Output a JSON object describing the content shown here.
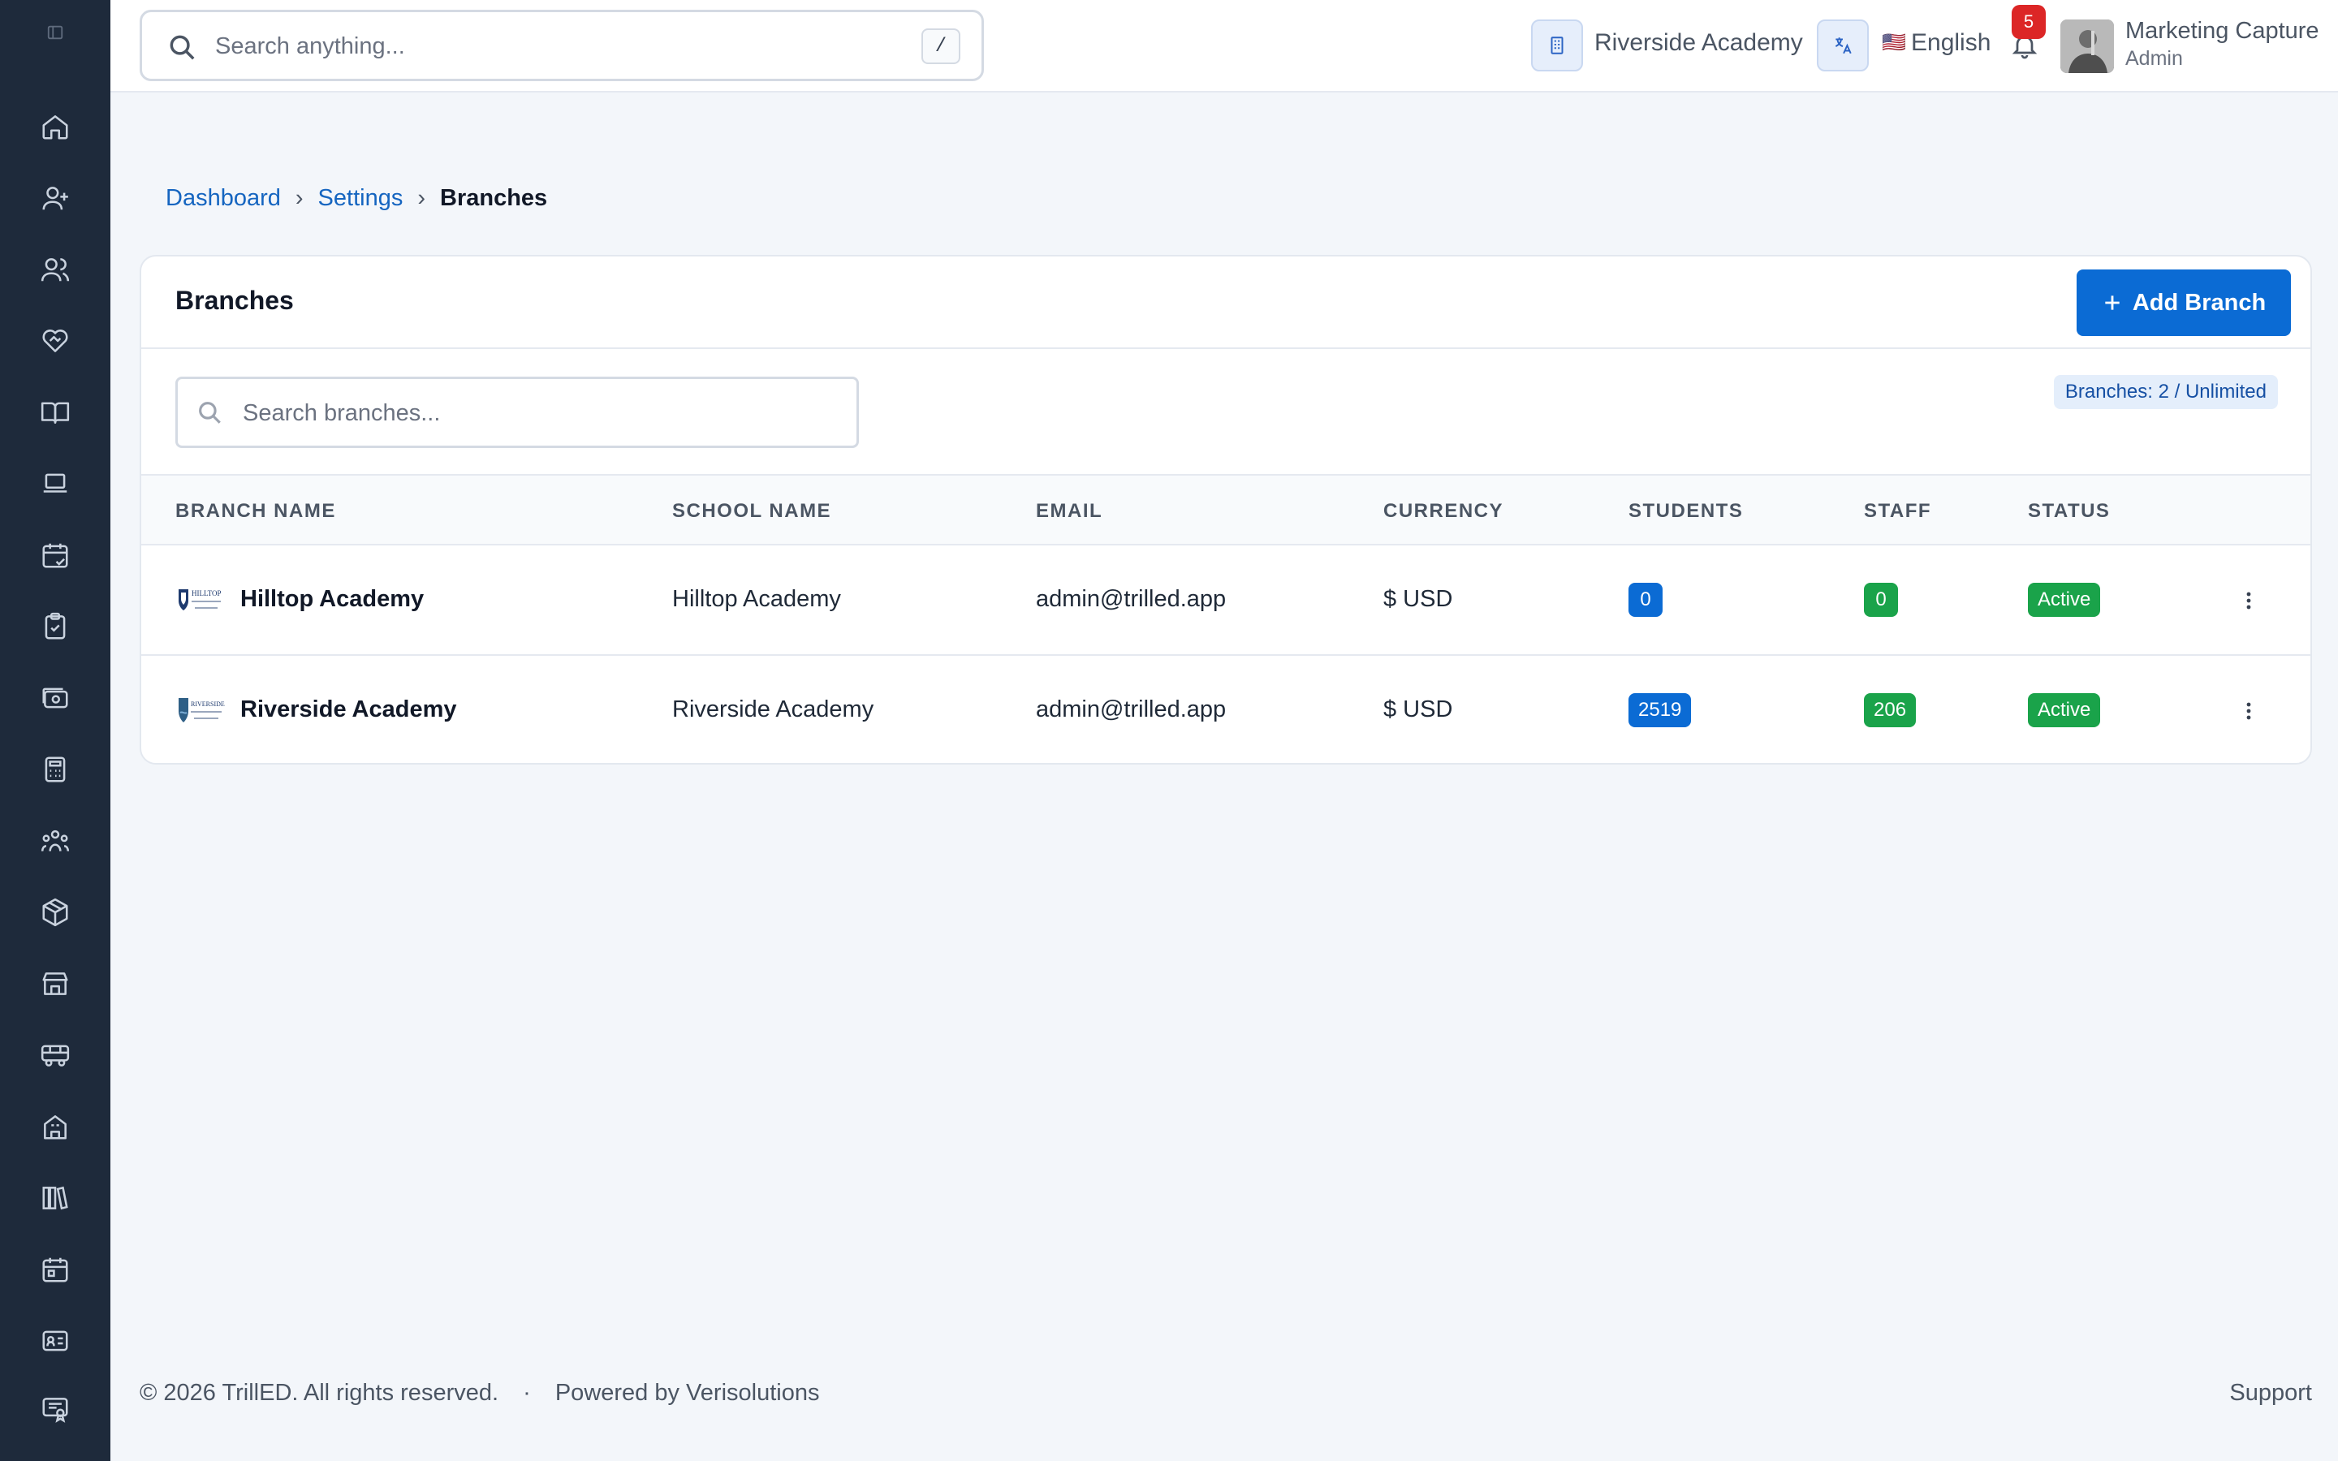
{
  "sidebar": {
    "items": [
      {
        "icon": "home-icon",
        "name": "sidebar-item-home"
      },
      {
        "icon": "user-plus-icon",
        "name": "sidebar-item-admissions"
      },
      {
        "icon": "users-icon",
        "name": "sidebar-item-students"
      },
      {
        "icon": "heart-handshake-icon",
        "name": "sidebar-item-guardians"
      },
      {
        "icon": "book-open-icon",
        "name": "sidebar-item-academics"
      },
      {
        "icon": "laptop-icon",
        "name": "sidebar-item-online-classes"
      },
      {
        "icon": "calendar-check-icon",
        "name": "sidebar-item-attendance"
      },
      {
        "icon": "clipboard-check-icon",
        "name": "sidebar-item-exams"
      },
      {
        "icon": "banknote-icon",
        "name": "sidebar-item-fees"
      },
      {
        "icon": "calculator-icon",
        "name": "sidebar-item-accounting"
      },
      {
        "icon": "people-group-icon",
        "name": "sidebar-item-hr"
      },
      {
        "icon": "package-icon",
        "name": "sidebar-item-inventory"
      },
      {
        "icon": "store-icon",
        "name": "sidebar-item-store"
      },
      {
        "icon": "bus-icon",
        "name": "sidebar-item-transport"
      },
      {
        "icon": "building-icon",
        "name": "sidebar-item-hostel"
      },
      {
        "icon": "library-icon",
        "name": "sidebar-item-library"
      },
      {
        "icon": "calendar-icon",
        "name": "sidebar-item-events"
      },
      {
        "icon": "id-card-icon",
        "name": "sidebar-item-id-cards"
      },
      {
        "icon": "certificate-icon",
        "name": "sidebar-item-certificates"
      }
    ]
  },
  "topbar": {
    "search_placeholder": "Search anything...",
    "shortcut": "/",
    "school": "Riverside Academy",
    "language_flag": "🇺🇸",
    "language": "English",
    "notifications": "5",
    "user_name": "Marketing Capture",
    "user_role": "Admin"
  },
  "breadcrumb": {
    "items": [
      "Dashboard",
      "Settings"
    ],
    "current": "Branches",
    "separator": "›"
  },
  "card": {
    "title": "Branches",
    "add_button": "Add Branch",
    "search_placeholder": "Search branches...",
    "quota": "Branches: 2 / Unlimited"
  },
  "table": {
    "headers": [
      "Branch Name",
      "School Name",
      "Email",
      "Currency",
      "Students",
      "Staff",
      "Status"
    ],
    "rows": [
      {
        "branch": "Hilltop Academy",
        "school": "Hilltop Academy",
        "email": "admin@trilled.app",
        "currency": "$ USD",
        "students": "0",
        "staff": "0",
        "status": "Active",
        "logo_text": "HILLTOP"
      },
      {
        "branch": "Riverside Academy",
        "school": "Riverside Academy",
        "email": "admin@trilled.app",
        "currency": "$ USD",
        "students": "2519",
        "staff": "206",
        "status": "Active",
        "logo_text": "RIVERSIDE"
      }
    ]
  },
  "footer": {
    "copyright": "© 2026 TrillED. All rights reserved.",
    "separator": "·",
    "powered": "Powered by Verisolutions",
    "support": "Support"
  },
  "colors": {
    "sidebar_bg": "#1e2a3b",
    "accent": "#0b6bd4",
    "success": "#1aa34a",
    "danger": "#dc2626"
  }
}
